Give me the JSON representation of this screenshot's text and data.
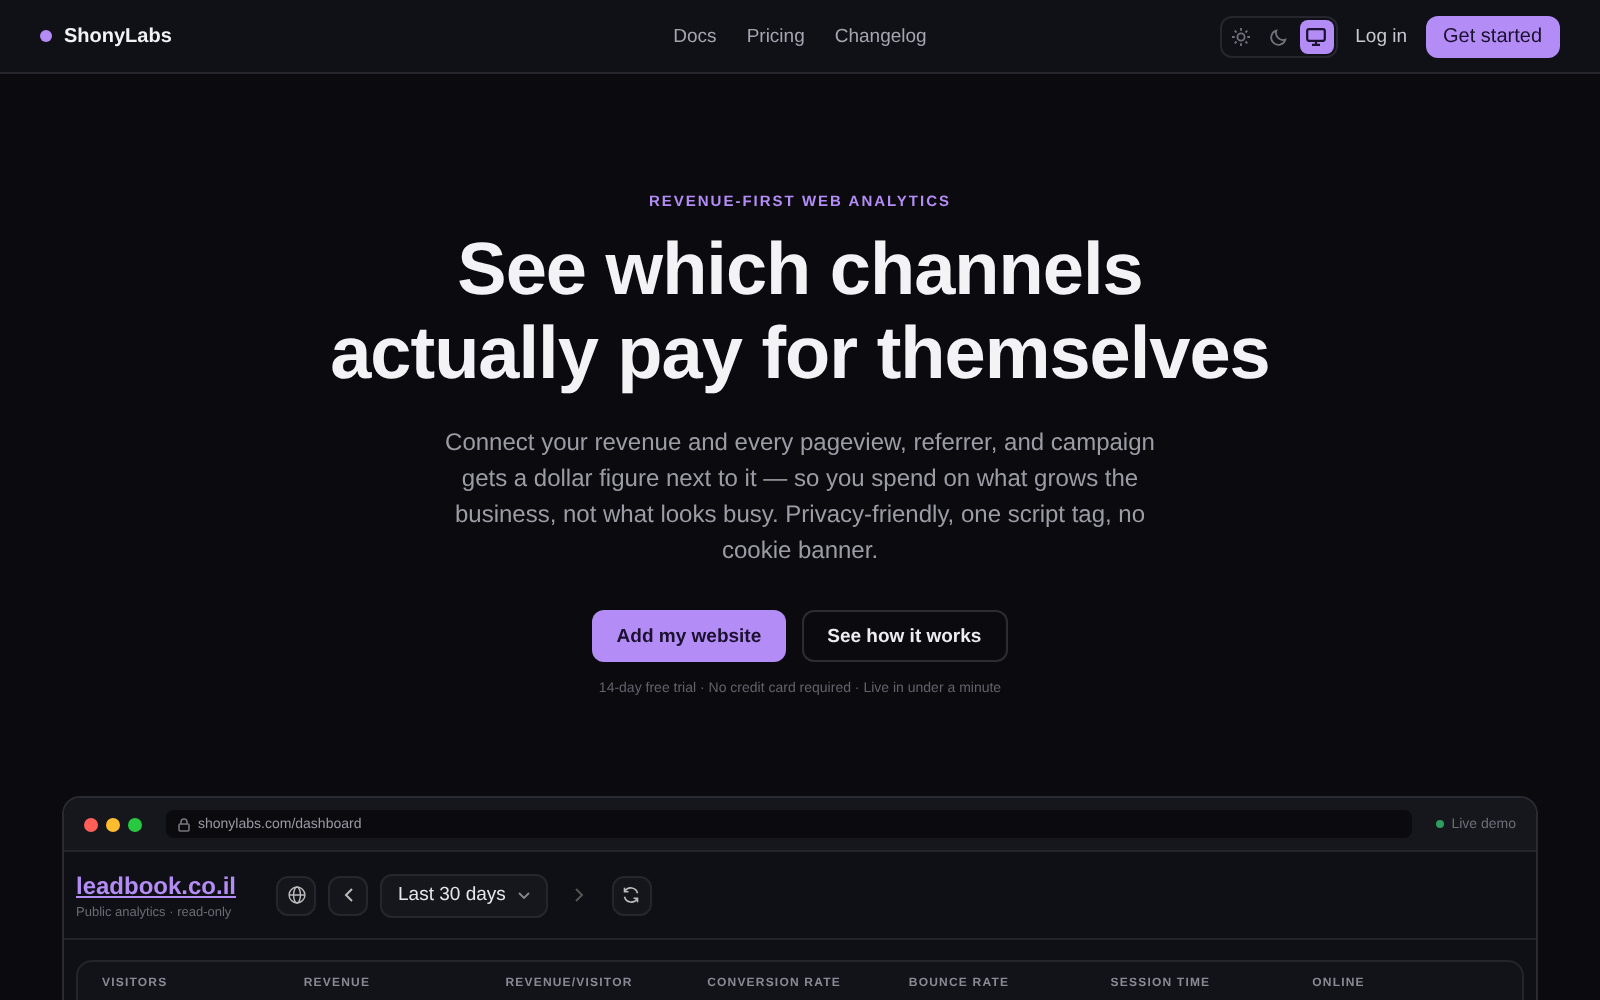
{
  "nav": {
    "brand": "ShonyLabs",
    "links": [
      "Docs",
      "Pricing",
      "Changelog"
    ],
    "theme_options": [
      {
        "kind": "sun",
        "selected": false
      },
      {
        "kind": "moon",
        "selected": false
      },
      {
        "kind": "monitor",
        "selected": true
      }
    ],
    "login": "Log in",
    "cta": "Get started"
  },
  "hero": {
    "eyebrow": "REVENUE-FIRST WEB ANALYTICS",
    "title_lines": [
      "See which channels",
      "actually pay for themselves"
    ],
    "description": "Connect your revenue and every pageview, referrer, and campaign gets a dollar figure next to it — so you spend on what grows the business, not what looks busy. Privacy-friendly, one script tag, no cookie banner.",
    "primary_button": "Add my website",
    "secondary_button": "See how it works",
    "note": "14-day free trial · No credit card required · Live in under a minute"
  },
  "dashboard": {
    "url": "shonylabs.com/dashboard",
    "badge": "Live demo",
    "site": "leadbook.co.il",
    "subtitle": "Public analytics · read-only",
    "range": "Last 30 days",
    "stats": [
      "VISITORS",
      "REVENUE",
      "REVENUE/VISITOR",
      "CONVERSION RATE",
      "BOUNCE RATE",
      "SESSION TIME",
      "ONLINE"
    ]
  }
}
